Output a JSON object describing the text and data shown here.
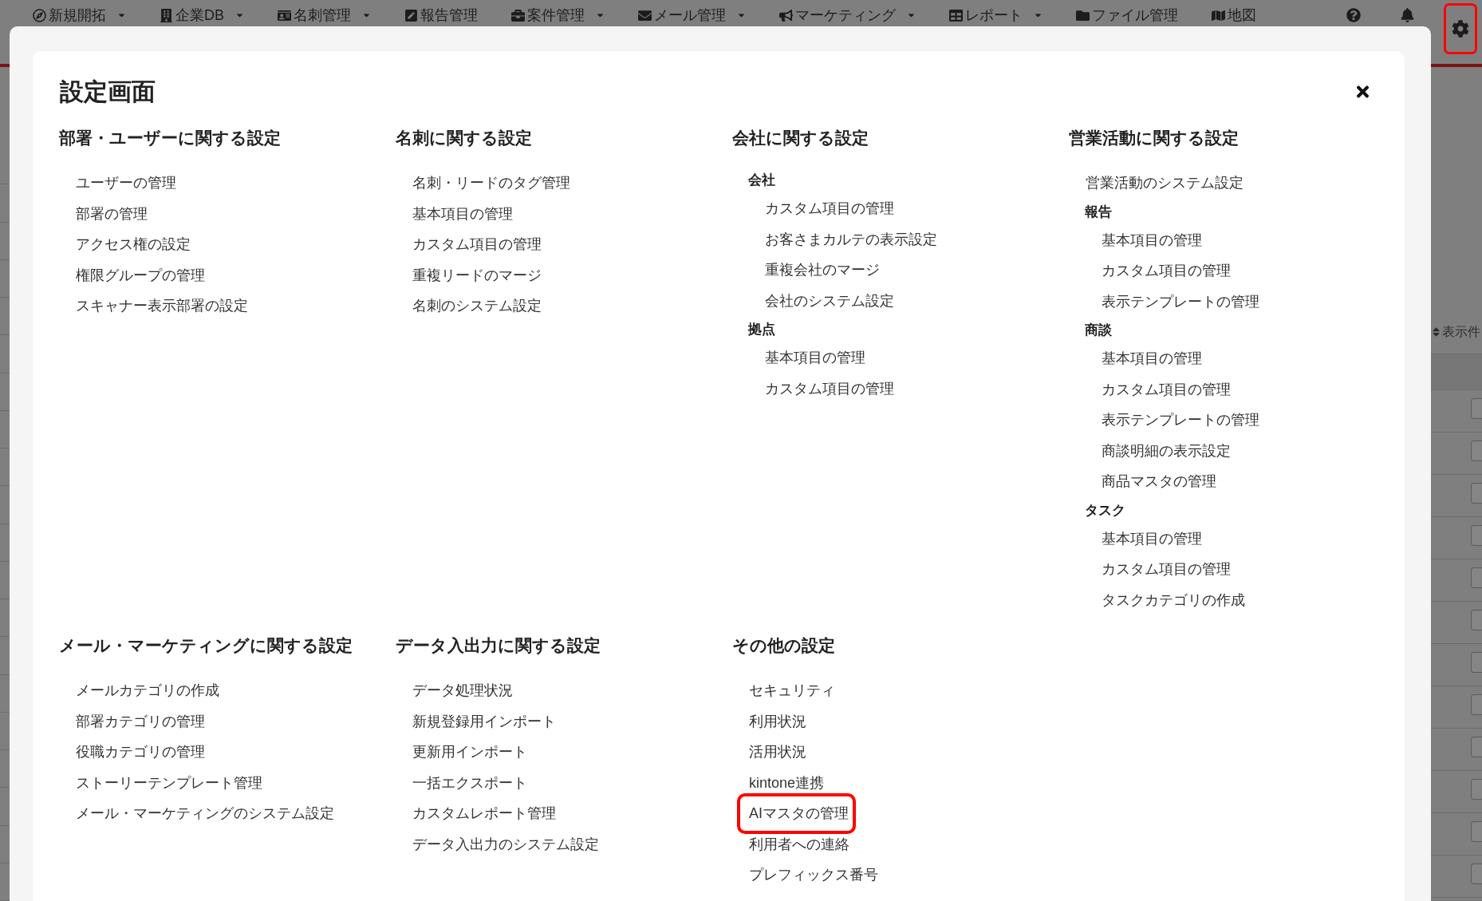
{
  "top_nav": {
    "items": [
      {
        "label": "新規開拓",
        "dropdown": true
      },
      {
        "label": "企業DB",
        "dropdown": true
      },
      {
        "label": "名刺管理",
        "dropdown": true
      },
      {
        "label": "報告管理",
        "dropdown": false
      },
      {
        "label": "案件管理",
        "dropdown": true
      },
      {
        "label": "メール管理",
        "dropdown": true
      },
      {
        "label": "マーケティング",
        "dropdown": true
      },
      {
        "label": "レポート",
        "dropdown": true
      },
      {
        "label": "ファイル管理",
        "dropdown": false
      },
      {
        "label": "地図",
        "dropdown": false
      }
    ],
    "tools": [
      {
        "kind": "help",
        "highlighted": false
      },
      {
        "kind": "notifications",
        "highlighted": false
      },
      {
        "kind": "settings",
        "highlighted": true
      }
    ]
  },
  "background_page": {
    "list_caption": "表示件"
  },
  "settings_dialog": {
    "title": "設定画面",
    "sections": [
      {
        "heading": "部署・ユーザーに関する設定",
        "entries": [
          {
            "kind": "link",
            "label": "ユーザーの管理"
          },
          {
            "kind": "link",
            "label": "部署の管理"
          },
          {
            "kind": "link",
            "label": "アクセス権の設定"
          },
          {
            "kind": "link",
            "label": "権限グループの管理"
          },
          {
            "kind": "link",
            "label": "スキャナー表示部署の設定"
          }
        ]
      },
      {
        "heading": "名刺に関する設定",
        "entries": [
          {
            "kind": "link",
            "label": "名刺・リードのタグ管理"
          },
          {
            "kind": "link",
            "label": "基本項目の管理"
          },
          {
            "kind": "link",
            "label": "カスタム項目の管理"
          },
          {
            "kind": "link",
            "label": "重複リードのマージ"
          },
          {
            "kind": "link",
            "label": "名刺のシステム設定"
          }
        ]
      },
      {
        "heading": "会社に関する設定",
        "entries": [
          {
            "kind": "group",
            "label": "会社",
            "children": [
              {
                "kind": "link",
                "label": "カスタム項目の管理"
              },
              {
                "kind": "link",
                "label": "お客さまカルテの表示設定"
              },
              {
                "kind": "link",
                "label": "重複会社のマージ"
              },
              {
                "kind": "link",
                "label": "会社のシステム設定"
              }
            ]
          },
          {
            "kind": "group",
            "label": "拠点",
            "children": [
              {
                "kind": "link",
                "label": "基本項目の管理"
              },
              {
                "kind": "link",
                "label": "カスタム項目の管理"
              }
            ]
          }
        ]
      },
      {
        "heading": "営業活動に関する設定",
        "entries": [
          {
            "kind": "link",
            "label": "営業活動のシステム設定"
          },
          {
            "kind": "group",
            "label": "報告",
            "children": [
              {
                "kind": "link",
                "label": "基本項目の管理"
              },
              {
                "kind": "link",
                "label": "カスタム項目の管理"
              },
              {
                "kind": "link",
                "label": "表示テンプレートの管理"
              }
            ]
          },
          {
            "kind": "group",
            "label": "商談",
            "children": [
              {
                "kind": "link",
                "label": "基本項目の管理"
              },
              {
                "kind": "link",
                "label": "カスタム項目の管理"
              },
              {
                "kind": "link",
                "label": "表示テンプレートの管理"
              },
              {
                "kind": "link",
                "label": "商談明細の表示設定"
              },
              {
                "kind": "link",
                "label": "商品マスタの管理"
              }
            ]
          },
          {
            "kind": "group",
            "label": "タスク",
            "children": [
              {
                "kind": "link",
                "label": "基本項目の管理"
              },
              {
                "kind": "link",
                "label": "カスタム項目の管理"
              },
              {
                "kind": "link",
                "label": "タスクカテゴリの作成"
              }
            ]
          }
        ]
      },
      {
        "heading": "メール・マーケティングに関する設定",
        "entries": [
          {
            "kind": "link",
            "label": "メールカテゴリの作成"
          },
          {
            "kind": "link",
            "label": "部署カテゴリの管理"
          },
          {
            "kind": "link",
            "label": "役職カテゴリの管理"
          },
          {
            "kind": "link",
            "label": "ストーリーテンプレート管理"
          },
          {
            "kind": "link",
            "label": "メール・マーケティングのシステム設定"
          }
        ]
      },
      {
        "heading": "データ入出力に関する設定",
        "entries": [
          {
            "kind": "link",
            "label": "データ処理状況"
          },
          {
            "kind": "link",
            "label": "新規登録用インポート"
          },
          {
            "kind": "link",
            "label": "更新用インポート"
          },
          {
            "kind": "link",
            "label": "一括エクスポート"
          },
          {
            "kind": "link",
            "label": "カスタムレポート管理"
          },
          {
            "kind": "link",
            "label": "データ入出力のシステム設定"
          }
        ]
      },
      {
        "heading": "その他の設定",
        "entries": [
          {
            "kind": "link",
            "label": "セキュリティ",
            "highlighted": false
          },
          {
            "kind": "link",
            "label": "利用状況",
            "highlighted": false
          },
          {
            "kind": "link",
            "label": "活用状況",
            "highlighted": false
          },
          {
            "kind": "link",
            "label": "kintone連携",
            "highlighted": false
          },
          {
            "kind": "link",
            "label": "AIマスタの管理",
            "highlighted": true
          },
          {
            "kind": "link",
            "label": "利用者への連絡",
            "highlighted": false
          },
          {
            "kind": "link",
            "label": "プレフィックス番号",
            "highlighted": false
          }
        ]
      }
    ]
  }
}
